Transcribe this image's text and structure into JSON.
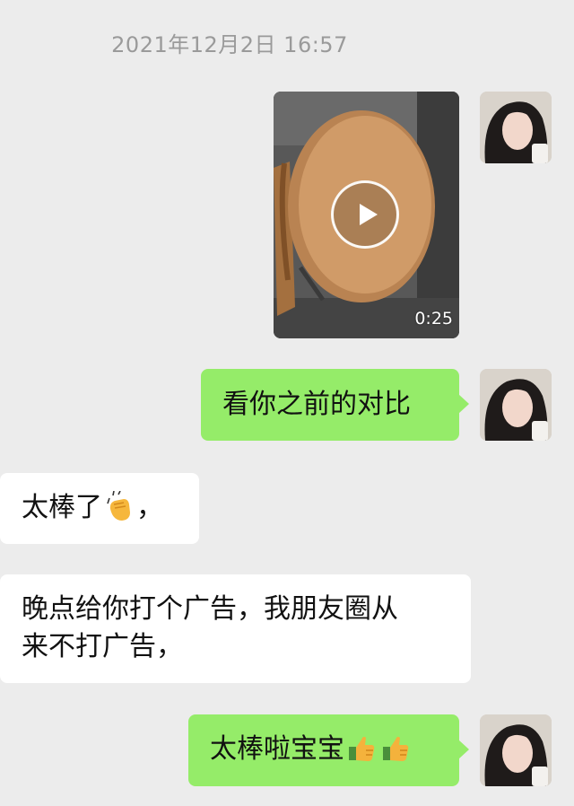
{
  "chat": {
    "timestamp": "2021年12月2日 16:57",
    "video": {
      "duration": "0:25"
    },
    "messages": [
      {
        "text": "看你之前的对比"
      },
      {
        "text_before": "太棒了",
        "text_after": "，",
        "emoji": "clapping-hands-icon"
      },
      {
        "line1": "晚点给你打个广告，我朋友圈从",
        "line2": "来不打广告，"
      },
      {
        "text": "太棒啦宝宝",
        "emoji": "thumbs-up-icon"
      }
    ]
  },
  "colors": {
    "background": "#ececec",
    "sent_bubble": "#95ec69",
    "received_bubble": "#ffffff",
    "timestamp_text": "#9a9a9a"
  }
}
